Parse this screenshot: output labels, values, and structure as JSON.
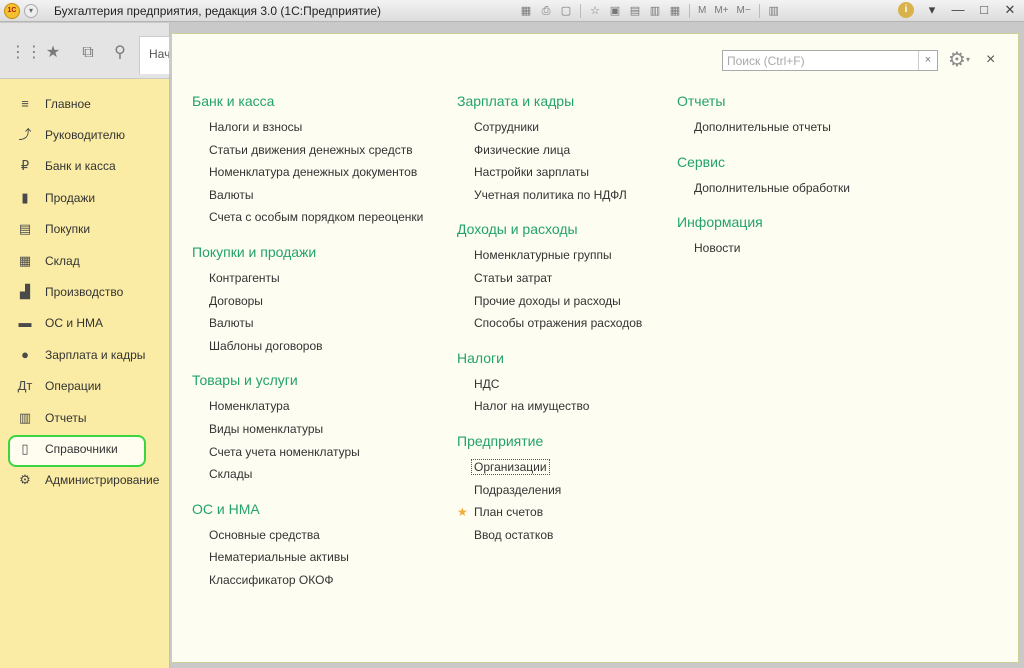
{
  "window": {
    "title": "Бухгалтерия предприятия, редакция 3.0  (1С:Предприятие)",
    "logo_text": "1С",
    "toolbar_text": [
      "M",
      "M+",
      "M−"
    ]
  },
  "sidebar": {
    "tab_label": "Нач",
    "items": [
      {
        "label": "Главное",
        "icon": "≡"
      },
      {
        "label": "Руководителю",
        "icon": "⤴"
      },
      {
        "label": "Банк и касса",
        "icon": "₽"
      },
      {
        "label": "Продажи",
        "icon": "▮"
      },
      {
        "label": "Покупки",
        "icon": "▤"
      },
      {
        "label": "Склад",
        "icon": "▦"
      },
      {
        "label": "Производство",
        "icon": "▟"
      },
      {
        "label": "ОС и НМА",
        "icon": "▬"
      },
      {
        "label": "Зарплата и кадры",
        "icon": "●"
      },
      {
        "label": "Операции",
        "icon": "Дт"
      },
      {
        "label": "Отчеты",
        "icon": "▥"
      },
      {
        "label": "Справочники",
        "icon": "▯"
      },
      {
        "label": "Администрирование",
        "icon": "⚙"
      }
    ],
    "active_index": 11
  },
  "search": {
    "placeholder": "Поиск (Ctrl+F)",
    "value": ""
  },
  "columns": [
    {
      "sections": [
        {
          "title": "Банк и касса",
          "items": [
            "Налоги и взносы",
            "Статьи движения денежных средств",
            "Номенклатура денежных документов",
            "Валюты",
            "Счета с особым порядком переоценки"
          ]
        },
        {
          "title": "Покупки и продажи",
          "items": [
            "Контрагенты",
            "Договоры",
            "Валюты",
            "Шаблоны договоров"
          ]
        },
        {
          "title": "Товары и услуги",
          "items": [
            "Номенклатура",
            "Виды номенклатуры",
            "Счета учета номенклатуры",
            "Склады"
          ]
        },
        {
          "title": "ОС и НМА",
          "items": [
            "Основные средства",
            "Нематериальные активы",
            "Классификатор ОКОФ"
          ]
        }
      ]
    },
    {
      "sections": [
        {
          "title": "Зарплата и кадры",
          "items": [
            "Сотрудники",
            "Физические лица",
            "Настройки зарплаты",
            "Учетная политика по НДФЛ"
          ]
        },
        {
          "title": "Доходы и расходы",
          "items": [
            "Номенклатурные группы",
            "Статьи затрат",
            "Прочие доходы и расходы",
            "Способы отражения расходов"
          ]
        },
        {
          "title": "Налоги",
          "items": [
            "НДС",
            "Налог на имущество"
          ]
        },
        {
          "title": "Предприятие",
          "items": [
            "Организации",
            "Подразделения",
            "План счетов",
            "Ввод остатков"
          ]
        }
      ]
    },
    {
      "sections": [
        {
          "title": "Отчеты",
          "items": [
            "Дополнительные отчеты"
          ]
        },
        {
          "title": "Сервис",
          "items": [
            "Дополнительные обработки"
          ]
        },
        {
          "title": "Информация",
          "items": [
            "Новости"
          ]
        }
      ]
    }
  ],
  "colors": {
    "section_title": "#23a36a",
    "sidebar_bg": "#fbeca5",
    "content_bg": "#fdfdf2",
    "active_outline": "#39d640",
    "favorite_star": "#f2a93b"
  }
}
